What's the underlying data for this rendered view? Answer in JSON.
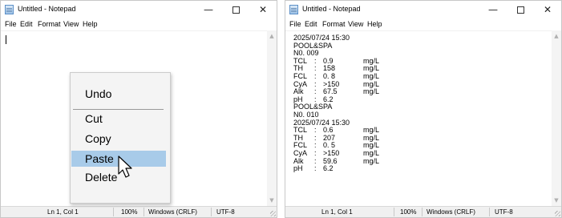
{
  "left_window": {
    "title": "Untitled - Notepad",
    "controls": {
      "minimize": "—",
      "close": "✕"
    },
    "menu": [
      "File",
      "Edit",
      "Format",
      "View",
      "Help"
    ],
    "context_menu": {
      "items": [
        "Undo",
        "Cut",
        "Copy",
        "Paste",
        "Delete"
      ],
      "highlighted": "Paste"
    },
    "status": {
      "position": "Ln 1, Col 1",
      "zoom": "100%",
      "line_endings": "Windows (CRLF)",
      "encoding": "UTF-8"
    }
  },
  "right_window": {
    "title": "Untitled - Notepad",
    "controls": {
      "minimize": "—",
      "close": "✕"
    },
    "menu": [
      "File",
      "Edit",
      "Format",
      "View",
      "Help"
    ],
    "lines": [
      {
        "text": "2025/07/24 15:30"
      },
      {
        "text": "POOL&SPA"
      },
      {
        "text": "N0. 009"
      },
      {
        "name": "TCL",
        "colon": ":",
        "value": "0.9",
        "unit": "mg/L"
      },
      {
        "name": "TH",
        "colon": ":",
        "value": "158",
        "unit": "mg/L"
      },
      {
        "name": "FCL",
        "colon": ":",
        "value": "0. 8",
        "unit": "mg/L"
      },
      {
        "name": "CyA",
        "colon": ":",
        "value": ">150",
        "unit": "mg/L"
      },
      {
        "name": "Alk",
        "colon": ":",
        "value": "67.5",
        "unit": "mg/L"
      },
      {
        "name": "pH",
        "colon": ":",
        "value": "6.2",
        "unit": ""
      },
      {
        "text": "POOL&SPA"
      },
      {
        "text": "N0. 010"
      },
      {
        "text": "2025/07/24 15:30"
      },
      {
        "name": "TCL",
        "colon": ":",
        "value": "0.6",
        "unit": "mg/L"
      },
      {
        "name": "TH",
        "colon": ":",
        "value": "207",
        "unit": "mg/L"
      },
      {
        "name": "FCL",
        "colon": ":",
        "value": "0. 5",
        "unit": "mg/L"
      },
      {
        "name": "CyA",
        "colon": ":",
        "value": ">150",
        "unit": "mg/L"
      },
      {
        "name": "Alk",
        "colon": ":",
        "value": "59.6",
        "unit": "mg/L"
      },
      {
        "name": "pH",
        "colon": ":",
        "value": "6.2",
        "unit": ""
      }
    ],
    "status": {
      "position": "Ln 1, Col 1",
      "zoom": "100%",
      "line_endings": "Windows (CRLF)",
      "encoding": "UTF-8"
    }
  }
}
